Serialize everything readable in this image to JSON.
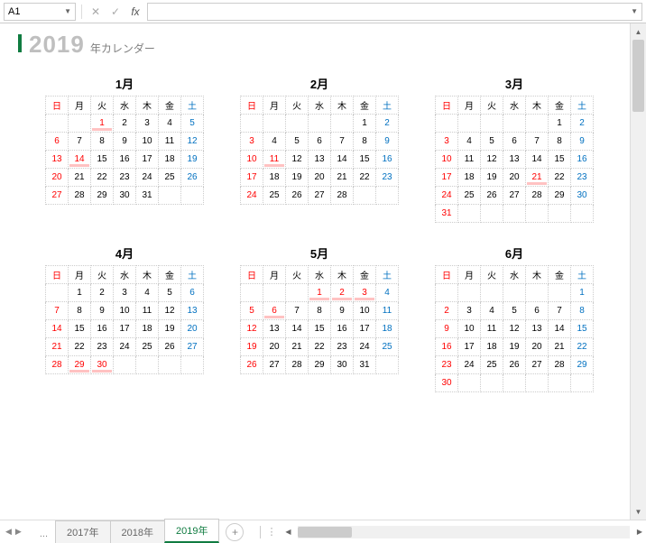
{
  "cell_ref": "A1",
  "title_year": "2019",
  "title_suffix": "年カレンダー",
  "weekdays": [
    "日",
    "月",
    "火",
    "水",
    "木",
    "金",
    "土"
  ],
  "tabs": [
    "2017年",
    "2018年",
    "2019年"
  ],
  "active_tab": 2,
  "months": [
    {
      "name": "1月",
      "start": 2,
      "days": 31,
      "holidays": [
        1,
        14
      ]
    },
    {
      "name": "2月",
      "start": 5,
      "days": 28,
      "holidays": [
        11
      ]
    },
    {
      "name": "3月",
      "start": 5,
      "days": 31,
      "holidays": [
        21
      ]
    },
    {
      "name": "4月",
      "start": 1,
      "days": 30,
      "holidays": [
        29,
        30
      ]
    },
    {
      "name": "5月",
      "start": 3,
      "days": 31,
      "holidays": [
        1,
        2,
        3,
        6
      ]
    },
    {
      "name": "6月",
      "start": 6,
      "days": 30,
      "holidays": []
    }
  ]
}
